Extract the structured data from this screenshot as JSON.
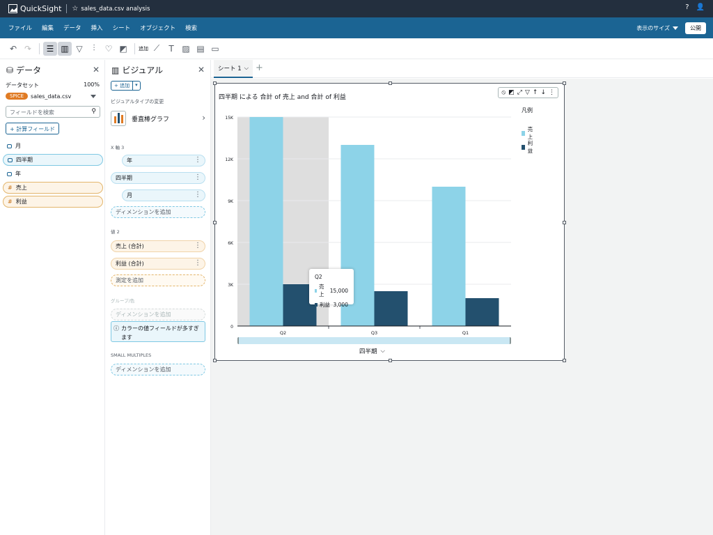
{
  "app": {
    "name": "QuickSight",
    "file_title": "sales_data.csv analysis"
  },
  "menu": [
    "ファイル",
    "編集",
    "データ",
    "挿入",
    "シート",
    "オブジェクト",
    "検索"
  ],
  "menu_right": {
    "size_label": "表示のサイズ",
    "publish_label": "公開"
  },
  "toolbar": {
    "add_label": "追加"
  },
  "data_panel": {
    "title": "データ",
    "dataset_label": "データセット",
    "dataset_pct": "100%",
    "spice_badge": "SPICE",
    "dataset_name": "sales_data.csv",
    "search_placeholder": "フィールドを検索",
    "calc_field_label": "+ 計算フィールド",
    "fields": [
      {
        "name": "月",
        "type": "dim"
      },
      {
        "name": "四半期",
        "type": "dim-selected"
      },
      {
        "name": "年",
        "type": "dim"
      },
      {
        "name": "売上",
        "type": "measure"
      },
      {
        "name": "利益",
        "type": "measure"
      }
    ]
  },
  "visual_panel": {
    "title": "ビジュアル",
    "add_label": "+ 追加",
    "visual_type_label": "ビジュアルタイプの変更",
    "visual_type": "垂直棒グラフ",
    "x_axis_label": "X 軸  3",
    "x_fields": [
      "年",
      "四半期",
      "月"
    ],
    "add_dimension": "ディメンションを追加",
    "value_label": "値  2",
    "value_fields": [
      "売上 (合計)",
      "利益 (合計)"
    ],
    "add_measure": "測定を追加",
    "group_label": "グループ/色",
    "group_add": "ディメンションを追加",
    "info_text": "カラーの値フィールドが多すぎます",
    "small_multiples_label": "SMALL MULTIPLES",
    "small_multiples_add": "ディメンションを追加"
  },
  "sheet": {
    "tab_label": "シート 1"
  },
  "chart_data": {
    "type": "bar",
    "title": "四半期 による 合計 of 売上 and 合計 of 利益",
    "categories": [
      "Q2",
      "Q3",
      "Q1"
    ],
    "series": [
      {
        "name": "売上",
        "values": [
          15000,
          13000,
          10000
        ],
        "color": "#8dd3e8"
      },
      {
        "name": "利益",
        "values": [
          3000,
          2500,
          2000
        ],
        "color": "#23506e"
      }
    ],
    "y_ticks": [
      0,
      3000,
      6000,
      9000,
      12000,
      15000
    ],
    "y_tick_labels": [
      "0",
      "3K",
      "6K",
      "9K",
      "12K",
      "15K"
    ],
    "ylim": [
      0,
      15000
    ],
    "xlabel": "四半期",
    "legend_title": "凡例",
    "legend_position": "right",
    "grid": true,
    "highlighted_category": "Q2"
  },
  "tooltip": {
    "title": "Q2",
    "row1": "売上",
    "value1": "15,000",
    "row2": "利益",
    "value2": "3,000"
  }
}
